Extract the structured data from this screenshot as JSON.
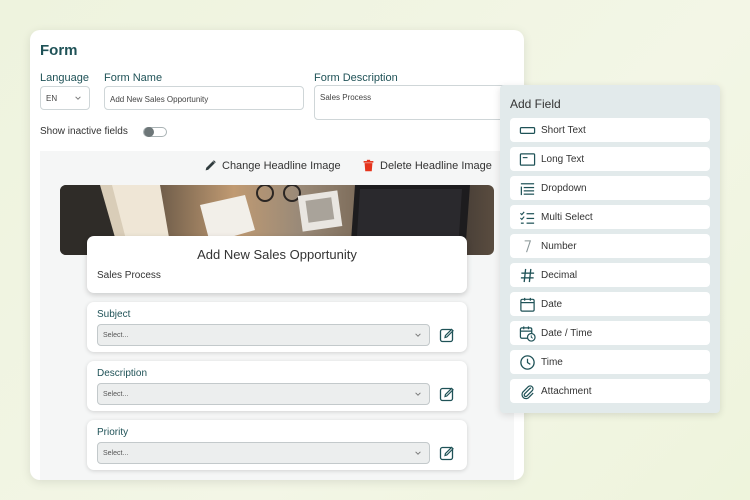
{
  "form": {
    "title": "Form",
    "language_label": "Language",
    "language_value": "EN",
    "form_name_label": "Form Name",
    "form_name_value": "Add New Sales Opportunity",
    "form_description_label": "Form Description",
    "form_description_value": "Sales Process",
    "show_inactive_label": "Show inactive fields",
    "show_inactive_on": false
  },
  "actions": {
    "change_image": "Change Headline Image",
    "delete_image": "Delete Headline Image"
  },
  "headline": {
    "title": "Add New Sales Opportunity",
    "subtitle": "Sales Process"
  },
  "fields": [
    {
      "label": "Subject",
      "placeholder": "Select..."
    },
    {
      "label": "Description",
      "placeholder": "Select..."
    },
    {
      "label": "Priority",
      "placeholder": "Select..."
    }
  ],
  "add_field": {
    "title": "Add Field",
    "items": [
      {
        "label": "Short Text",
        "icon": "short-text-icon"
      },
      {
        "label": "Long Text",
        "icon": "long-text-icon"
      },
      {
        "label": "Dropdown",
        "icon": "dropdown-icon"
      },
      {
        "label": "Multi Select",
        "icon": "multi-select-icon"
      },
      {
        "label": "Number",
        "icon": "number-icon"
      },
      {
        "label": "Decimal",
        "icon": "hash-icon"
      },
      {
        "label": "Date",
        "icon": "calendar-icon"
      },
      {
        "label": "Date / Time",
        "icon": "calendar-clock-icon"
      },
      {
        "label": "Time",
        "icon": "clock-icon"
      },
      {
        "label": "Attachment",
        "icon": "paperclip-icon"
      }
    ]
  },
  "colors": {
    "accent": "#1f5257",
    "delete": "#e5341c",
    "panel_bg": "#e2eaeb"
  }
}
